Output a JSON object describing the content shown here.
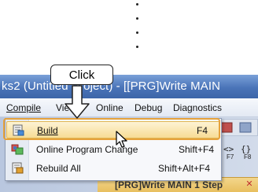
{
  "window": {
    "title": "ks2 (Untitled Project) - [[PRG]Write MAIN "
  },
  "menubar": {
    "items": [
      "Compile",
      "View",
      "Online",
      "Debug",
      "Diagnostics"
    ]
  },
  "dropdown": {
    "items": [
      {
        "label": "Build",
        "shortcut": "F4",
        "icon": "build-icon",
        "selected": true
      },
      {
        "label": "Online Program Change",
        "shortcut": "Shift+F4",
        "icon": "online-change-icon",
        "selected": false
      },
      {
        "label": "Rebuild All",
        "shortcut": "Shift+Alt+F4",
        "icon": "rebuild-icon",
        "selected": false
      }
    ]
  },
  "callout": {
    "label": "Click"
  },
  "tab": {
    "label": "[PRG]Write MAIN 1 Step"
  },
  "toolbar": {
    "key_f7": "F7",
    "key_f8": "F8"
  },
  "colors": {
    "titlebar": "#4a74b8",
    "highlight": "#e6a23c",
    "selection": "#f7dc95"
  }
}
